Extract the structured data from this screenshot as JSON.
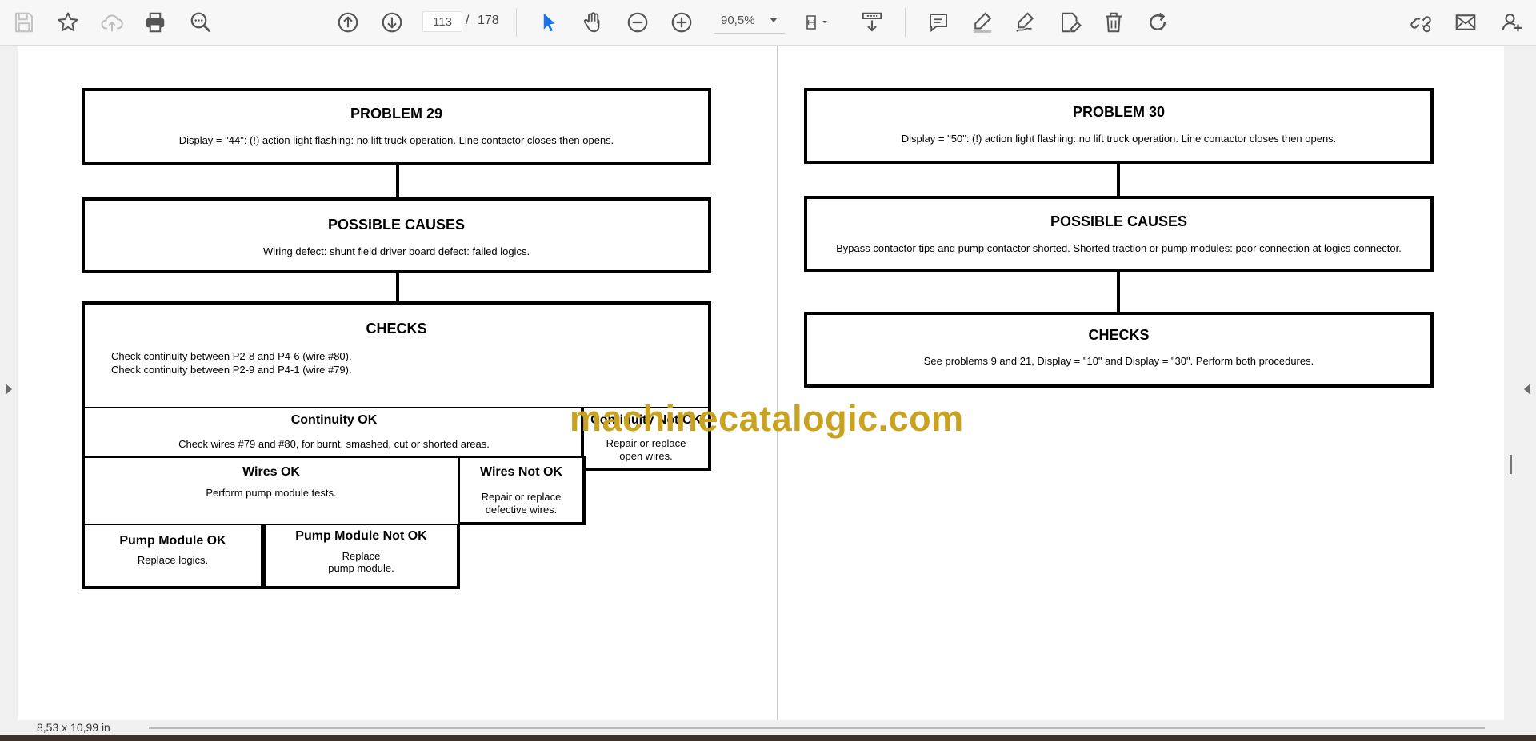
{
  "toolbar": {
    "current_page": "113",
    "page_separator": "/",
    "total_pages": "178",
    "zoom": "90,5%",
    "accent_color": "#1a73e8"
  },
  "status": {
    "page_size": "8,53 x 10,99 in"
  },
  "left_page": {
    "problem": {
      "title": "PROBLEM 29",
      "text": "Display = \"44\": (!) action light flashing: no lift truck operation.  Line contactor closes then opens."
    },
    "causes": {
      "title": "POSSIBLE CAUSES",
      "text": "Wiring defect: shunt field driver board defect: failed logics."
    },
    "checks": {
      "title": "CHECKS",
      "line1": "Check continuity between P2-8 and P4-6 (wire #80).",
      "line2": "Check continuity between P2-9 and P4-1 (wire #79)."
    },
    "continuity_ok": {
      "title": "Continuity OK",
      "text": "Check wires #79 and #80, for burnt, smashed, cut or shorted areas."
    },
    "continuity_not_ok": {
      "title": "Continuity Not OK",
      "line1": "Repair or replace",
      "line2": "open wires."
    },
    "wires_ok": {
      "title": "Wires OK",
      "text": "Perform pump module tests."
    },
    "wires_not_ok": {
      "title": "Wires Not OK",
      "line1": "Repair or replace",
      "line2": "defective wires."
    },
    "pump_ok": {
      "title": "Pump Module OK",
      "text": "Replace logics."
    },
    "pump_not_ok": {
      "title": "Pump Module Not OK",
      "line1": "Replace",
      "line2": "pump module."
    }
  },
  "right_page": {
    "problem": {
      "title": "PROBLEM 30",
      "text": "Display = \"50\": (!) action light flashing: no lift truck operation. Line contactor closes then opens."
    },
    "causes": {
      "title": "POSSIBLE CAUSES",
      "text": "Bypass contactor tips and pump contactor shorted. Shorted traction or pump modules: poor connection at logics connector."
    },
    "checks": {
      "title": "CHECKS",
      "text": "See problems 9 and 21, Display = \"10\" and Display = \"30\". Perform both procedures."
    }
  },
  "watermark": "machinecatalogic.com"
}
